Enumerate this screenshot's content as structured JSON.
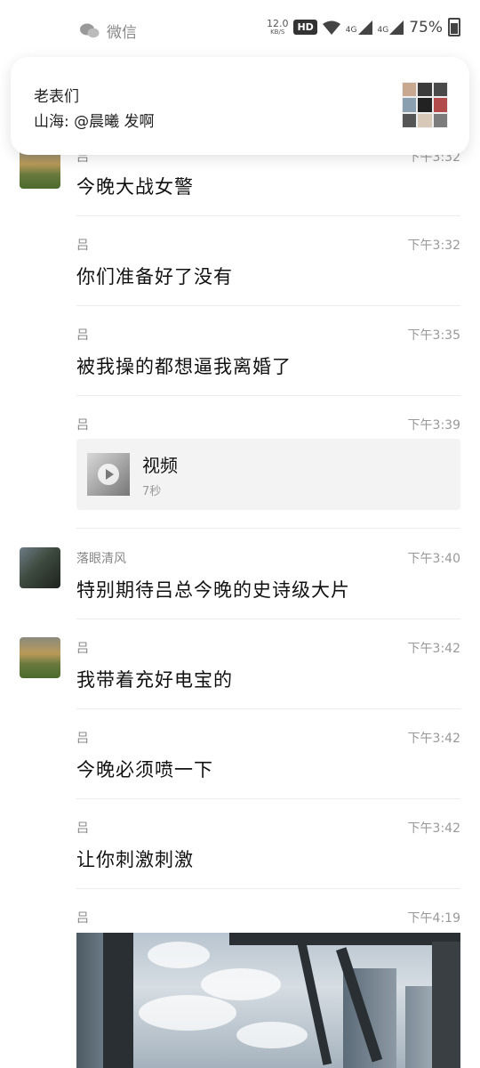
{
  "status_bar": {
    "app_name": "微信",
    "net_speed_value": "12.0",
    "net_speed_unit": "KB/S",
    "hd": "HD",
    "sim1": "4G",
    "sim2": "4G",
    "battery": "75%"
  },
  "notification": {
    "title": "老表们",
    "body": "山海: @晨曦 发啊"
  },
  "messages": [
    {
      "sender": "吕",
      "time": "下午3:32",
      "text": "今晚大战女警"
    },
    {
      "sender": "吕",
      "time": "下午3:32",
      "text": "你们准备好了没有"
    },
    {
      "sender": "吕",
      "time": "下午3:35",
      "text": "被我操的都想逼我离婚了"
    },
    {
      "sender": "吕",
      "time": "下午3:39",
      "video_title": "视频",
      "video_duration": "7秒"
    },
    {
      "sender": "落眼清风",
      "time": "下午3:40",
      "text": "特别期待吕总今晚的史诗级大片"
    },
    {
      "sender": "吕",
      "time": "下午3:42",
      "text": "我带着充好电宝的"
    },
    {
      "sender": "吕",
      "time": "下午3:42",
      "text": "今晚必须喷一下"
    },
    {
      "sender": "吕",
      "time": "下午3:42",
      "text": "让你刺激刺激"
    },
    {
      "sender": "吕",
      "time": "下午4:19"
    }
  ]
}
